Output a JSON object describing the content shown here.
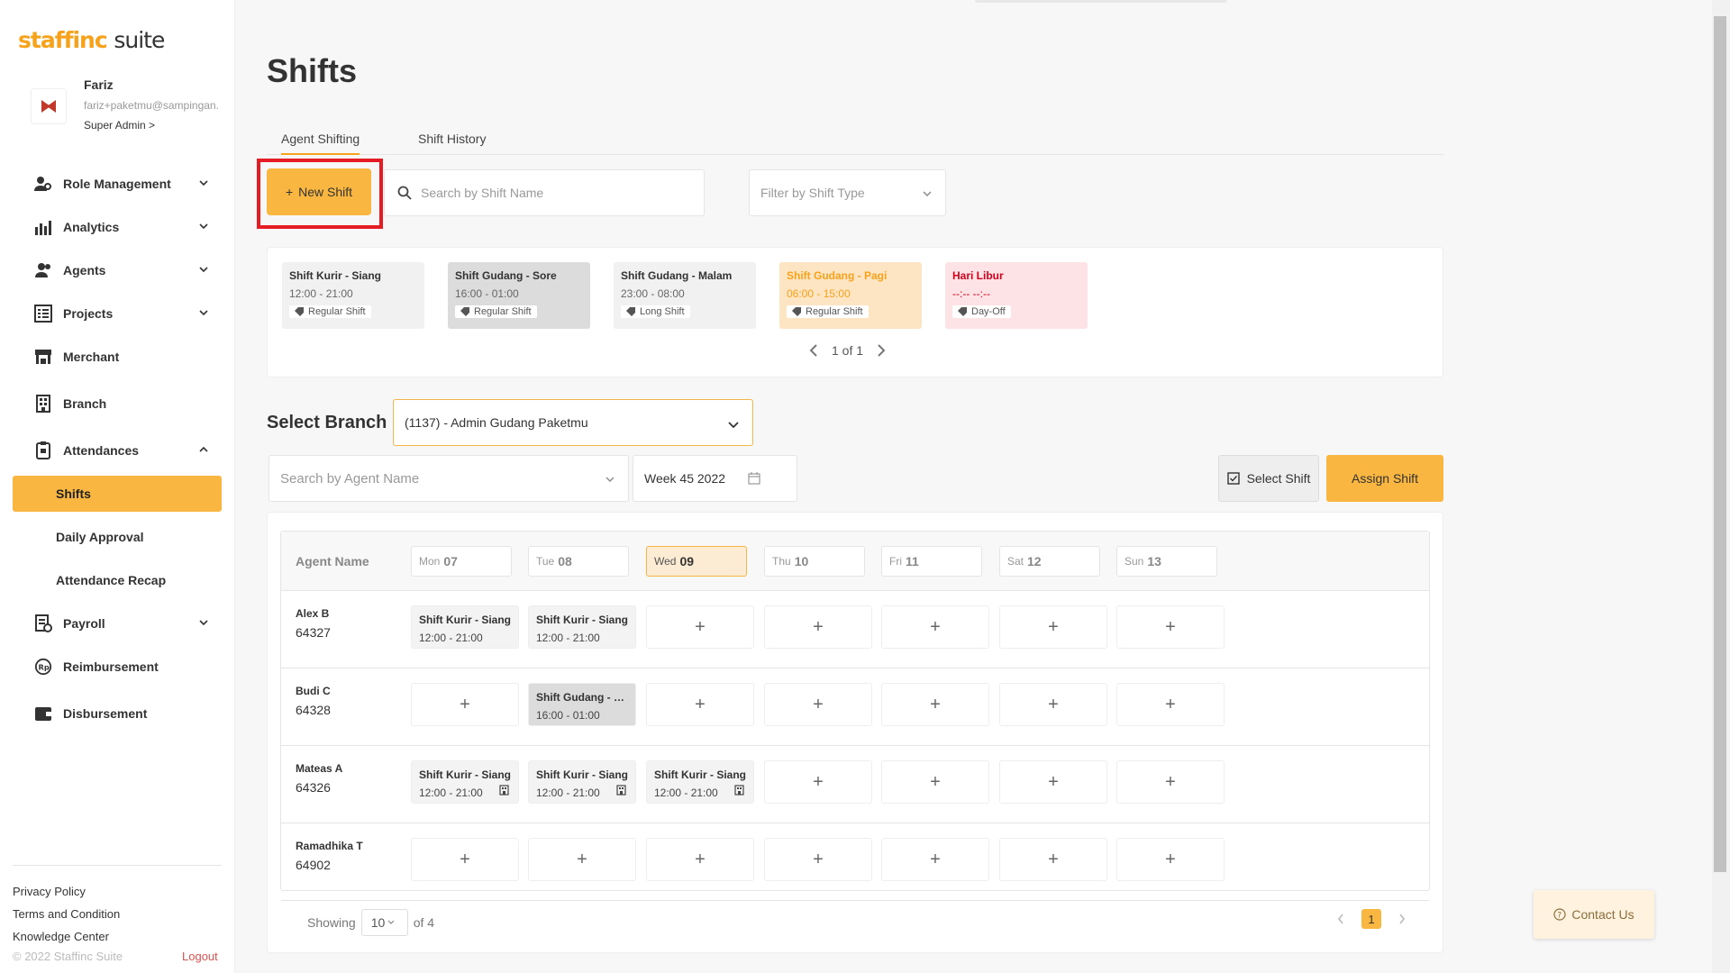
{
  "app": {
    "logo_brand": "staffinc",
    "logo_suite": "suite"
  },
  "user": {
    "name": "Fariz",
    "email": "fariz+paketmu@sampingan.",
    "role": "Super Admin >"
  },
  "sidebar": {
    "items": [
      {
        "label": "Role Management"
      },
      {
        "label": "Analytics"
      },
      {
        "label": "Agents"
      },
      {
        "label": "Projects"
      },
      {
        "label": "Merchant"
      },
      {
        "label": "Branch"
      },
      {
        "label": "Attendances"
      },
      {
        "label": "Payroll"
      },
      {
        "label": "Reimbursement"
      },
      {
        "label": "Disbursement"
      }
    ],
    "sub_items": [
      {
        "label": "Shifts"
      },
      {
        "label": "Daily Approval"
      },
      {
        "label": "Attendance Recap"
      }
    ],
    "footer": {
      "privacy": "Privacy Policy",
      "terms": "Terms and Condition",
      "knowledge": "Knowledge Center",
      "copyright": "© 2022 Staffinc Suite",
      "logout": "Logout"
    }
  },
  "page": {
    "title": "Shifts"
  },
  "tabs": [
    {
      "label": "Agent Shifting"
    },
    {
      "label": "Shift History"
    }
  ],
  "toolbar": {
    "new_shift": "New Shift",
    "search_placeholder": "Search by Shift Name",
    "filter_placeholder": "Filter by Shift Type"
  },
  "shift_types": [
    {
      "name": "Shift Kurir - Siang",
      "time": "12:00 - 21:00",
      "tag": "Regular Shift",
      "bg": "#f1f1f1",
      "color": "#333333"
    },
    {
      "name": "Shift Gudang - Sore",
      "time": "16:00 - 01:00",
      "tag": "Regular Shift",
      "bg": "#dcdcdc",
      "color": "#333333"
    },
    {
      "name": "Shift Gudang - Malam",
      "time": "23:00 - 08:00",
      "tag": "Long Shift",
      "bg": "#f1f1f1",
      "color": "#333333"
    },
    {
      "name": "Shift Gudang - Pagi",
      "time": "06:00 - 15:00",
      "tag": "Regular Shift",
      "bg": "#fde5c3",
      "color": "#f7a21b"
    },
    {
      "name": "Hari Libur",
      "time": "--:-- --:--",
      "tag": "Day-Off",
      "bg": "#fde3e6",
      "color": "#d0021b"
    }
  ],
  "shift_pager": {
    "label": "1 of 1"
  },
  "branch": {
    "label": "Select Branch",
    "value": "(1137) - Admin Gudang Paketmu"
  },
  "filters": {
    "agent_placeholder": "Search by Agent Name",
    "week": "Week 45 2022",
    "select_shift": "Select Shift",
    "assign_shift": "Assign Shift"
  },
  "grid": {
    "agent_col": "Agent Name",
    "days": [
      {
        "dow": "Mon",
        "num": "07"
      },
      {
        "dow": "Tue",
        "num": "08"
      },
      {
        "dow": "Wed",
        "num": "09"
      },
      {
        "dow": "Thu",
        "num": "10"
      },
      {
        "dow": "Fri",
        "num": "11"
      },
      {
        "dow": "Sat",
        "num": "12"
      },
      {
        "dow": "Sun",
        "num": "13"
      }
    ],
    "today_index": 2,
    "rows": [
      {
        "name": "Alex B",
        "id": "64327",
        "cells": [
          {
            "name": "Shift Kurir - Siang",
            "time": "12:00 - 21:00"
          },
          {
            "name": "Shift Kurir - Siang",
            "time": "12:00 - 21:00"
          },
          null,
          null,
          null,
          null,
          null
        ]
      },
      {
        "name": "Budi C",
        "id": "64328",
        "cells": [
          null,
          {
            "name": "Shift Gudang - So...",
            "time": "16:00 - 01:00",
            "dark": true
          },
          null,
          null,
          null,
          null,
          null
        ]
      },
      {
        "name": "Mateas A",
        "id": "64326",
        "cells": [
          {
            "name": "Shift Kurir - Siang",
            "time": "12:00 - 21:00",
            "icon": "building-icon"
          },
          {
            "name": "Shift Kurir - Siang",
            "time": "12:00 - 21:00",
            "icon": "building-icon"
          },
          {
            "name": "Shift Kurir - Siang",
            "time": "12:00 - 21:00",
            "icon": "building-icon"
          },
          null,
          null,
          null,
          null
        ]
      },
      {
        "name": "Ramadhika T",
        "id": "64902",
        "cells": [
          null,
          null,
          null,
          null,
          null,
          null,
          null
        ]
      }
    ],
    "add_symbol": "+",
    "footer": {
      "showing": "Showing",
      "per_page": "10",
      "of_total": "of 4",
      "current_page": "1"
    }
  },
  "contact": {
    "label": "Contact Us"
  },
  "colors": {
    "accent": "#f9b640",
    "brand": "#f7a21b",
    "highlight": "#e51c23"
  }
}
